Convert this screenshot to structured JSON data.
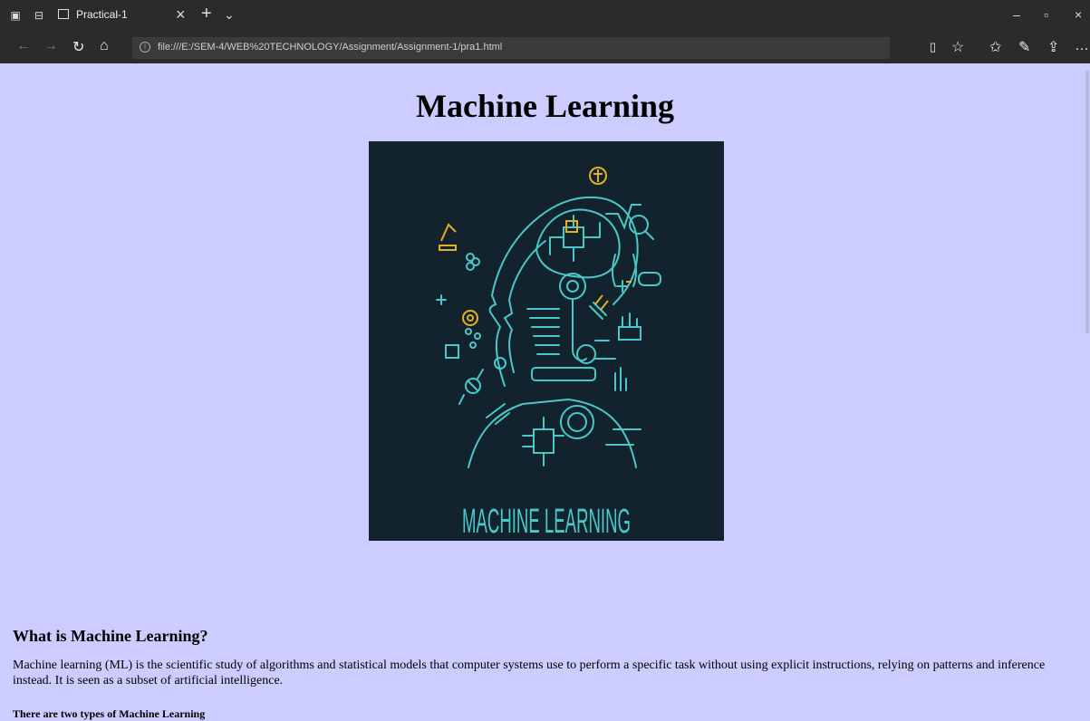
{
  "browser": {
    "tab_title": "Practical-1",
    "url": "file:///E:/SEM-4/WEB%20TECHNOLOGY/Assignment/Assignment-1/pra1.html"
  },
  "page": {
    "heading": "Machine Learning",
    "image_caption": "MACHINE LEARNING",
    "section_title": "What is Machine Learning?",
    "paragraph": "Machine learning (ML) is the scientific study of algorithms and statistical models that computer systems use to perform a specific task without using explicit instructions, relying on patterns and inference instead. It is seen as a subset of artificial intelligence.",
    "types_text": "There are two types of Machine Learning"
  },
  "colors": {
    "page_background": "#ccccff",
    "chrome_background": "#2b2b2b",
    "hero_background": "#13232e",
    "hero_line": "#48c8c8",
    "hero_accent": "#e2b020"
  }
}
